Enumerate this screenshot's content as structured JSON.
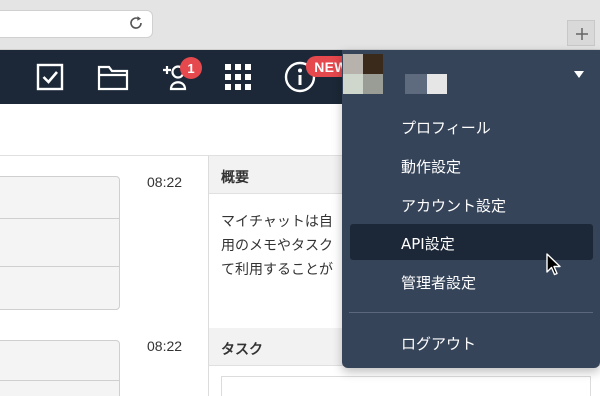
{
  "header": {
    "notification_count": "1",
    "new_badge": "NEW"
  },
  "messages": [
    {
      "time": "08:22"
    },
    {
      "time": "08:22"
    }
  ],
  "panel": {
    "overview_heading": "概要",
    "overview_lines": [
      "マイチャットは自",
      "用のメモやタスク",
      "て利用することが"
    ],
    "task_heading": "タスク"
  },
  "menu": {
    "items": [
      {
        "label": "プロフィール"
      },
      {
        "label": "動作設定"
      },
      {
        "label": "アカウント設定"
      },
      {
        "label": "API設定",
        "active": true
      },
      {
        "label": "管理者設定"
      }
    ],
    "logout": "ログアウト"
  },
  "colors": {
    "header_bg": "#1c2837",
    "menu_bg": "#36445a",
    "active_item_bg": "#1c2837",
    "badge_red": "#e5484d"
  }
}
